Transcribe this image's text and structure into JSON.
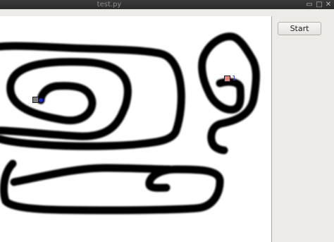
{
  "window": {
    "title": "test.py",
    "controls": {
      "minimize": "▭",
      "maximize": "□",
      "close": "✕"
    }
  },
  "toolbar": {
    "start_label": "Start"
  },
  "canvas": {
    "background": "#ffffff",
    "stroke_color": "#000000",
    "markers": [
      {
        "name": "start-marker",
        "fill": "#808080",
        "border": "#202020",
        "label": ""
      },
      {
        "name": "goal-marker",
        "fill": "#f08080",
        "border": "#202020",
        "label": "1"
      }
    ],
    "agent_color": "#1a2bd6"
  }
}
